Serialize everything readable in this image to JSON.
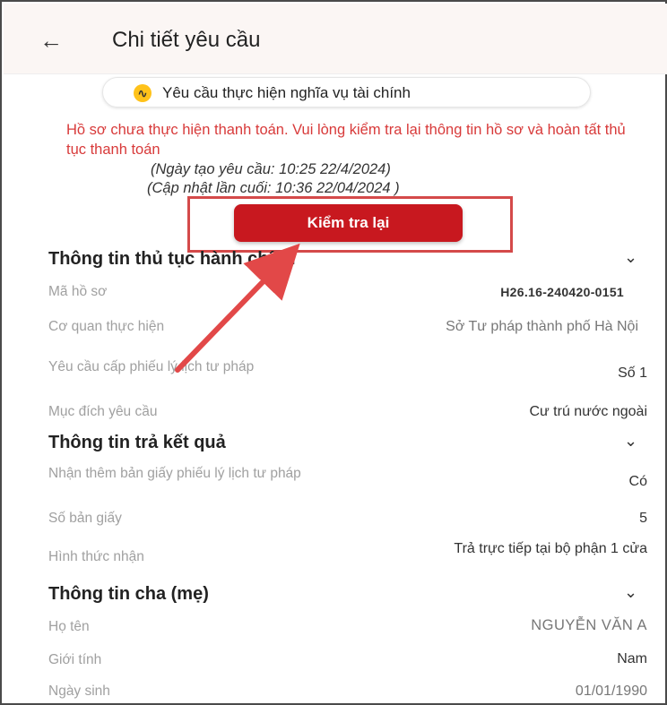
{
  "header": {
    "back_icon": "arrow-left-icon",
    "title": "Chi tiết yêu cầu"
  },
  "status_pill": {
    "icon": "wave-icon",
    "label": "Yêu cầu thực hiện nghĩa vụ tài chính"
  },
  "warning": {
    "text": "Hồ sơ chưa thực hiện thanh toán. Vui lòng kiểm tra lại thông tin hồ sơ và hoàn tất thủ tục thanh toán",
    "color": "#d83a3a"
  },
  "dates": {
    "created": "(Ngày tạo yêu cầu: 10:25  22/4/2024)",
    "updated": "(Cập nhật lần cuối: 10:36 22/04/2024 )"
  },
  "recheck_button": {
    "label": "Kiểm tra lại",
    "color": "#c8181f"
  },
  "sections": {
    "admin": {
      "title": "Thông tin thủ tục hành chính",
      "rows": [
        {
          "label": "Mã hồ sơ",
          "value": "H26.16-240420-0151"
        },
        {
          "label": "Cơ quan thực hiện",
          "value": "Sở Tư pháp thành phố Hà Nội"
        },
        {
          "label": "Yêu cầu cấp phiếu lý lịch tư pháp",
          "value": "Số 1"
        },
        {
          "label": "Mục đích yêu cầu",
          "value": "Cư trú nước ngoài"
        }
      ]
    },
    "result": {
      "title": "Thông tin trả kết quả",
      "rows": [
        {
          "label": "Nhận thêm bản giấy phiếu lý lịch tư pháp",
          "value": "Có"
        },
        {
          "label": "Số bản giấy",
          "value": "5"
        },
        {
          "label": "Hình thức nhận",
          "value": "Trả trực tiếp tại bộ phận 1 cửa"
        }
      ]
    },
    "parent": {
      "title": "Thông tin cha (mẹ)",
      "rows": [
        {
          "label": "Họ tên",
          "value": "NGUYỄN VĂN A"
        },
        {
          "label": "Giới tính",
          "value": "Nam"
        },
        {
          "label": "Ngày sinh",
          "value": "01/01/1990"
        }
      ]
    }
  }
}
